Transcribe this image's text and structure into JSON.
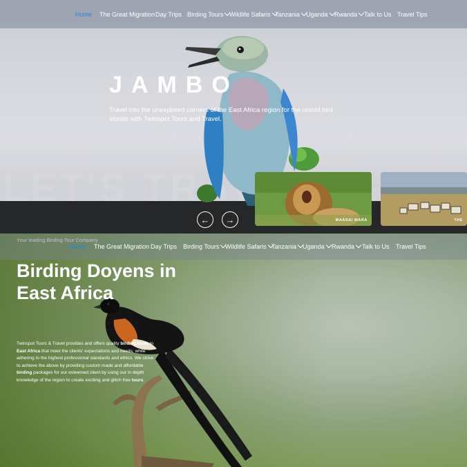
{
  "nav_top": [
    {
      "label": "Home",
      "active": true
    },
    {
      "label": "The Great Migration"
    },
    {
      "label": "Day Trips"
    },
    {
      "label": "Birding Tours",
      "caret": true
    },
    {
      "label": "Wildlife Safaris",
      "caret": true
    },
    {
      "label": "Tanzania",
      "caret": true
    },
    {
      "label": "Uganda",
      "caret": true
    },
    {
      "label": "Rwanda",
      "caret": true
    },
    {
      "label": "Talk to Us"
    },
    {
      "label": "Travel Tips"
    }
  ],
  "nav_second": [
    {
      "label": "Home",
      "active": true
    },
    {
      "label": "The Great Migration"
    },
    {
      "label": "Day Trips"
    },
    {
      "label": "Birding Tours",
      "caret": true
    },
    {
      "label": "Wildlife Safaris",
      "caret": true
    },
    {
      "label": "Tanzania",
      "caret": true
    },
    {
      "label": "Uganda",
      "caret": true
    },
    {
      "label": "Rwanda",
      "caret": true
    },
    {
      "label": "Talk to Us"
    },
    {
      "label": "Travel Tips"
    }
  ],
  "hero": {
    "title": "JAMBO",
    "subtitle": "Travel into the unexplored corners of the East Africa region for the untold bird stories with Twinspot Tours and Travel.",
    "ghost_text": "LET'S TRAVEL",
    "prev_label": "←",
    "next_label": "→"
  },
  "cards": [
    {
      "label": "MAASAI MARA"
    },
    {
      "label": "THE"
    }
  ],
  "section2": {
    "tagline": "Your leading Birding Tour Company",
    "heading": "Birding Doyens in East Africa",
    "para_parts": [
      {
        "text": "Twinspot Tours & Travel provides and offers quality ",
        "bold": false
      },
      {
        "text": "birding tours",
        "bold": true
      },
      {
        "text": " in ",
        "bold": false
      },
      {
        "text": "East Africa",
        "bold": true
      },
      {
        "text": " that meet the clients' expectations and needs, while adhering to the highest professional standards and ethics. We strive to achieve the above by providing custom made and affordable ",
        "bold": false
      },
      {
        "text": "birding",
        "bold": true
      },
      {
        "text": " packages for our esteemed client by using our in depth knowledge of the region to create exciting and glitch free ",
        "bold": false
      },
      {
        "text": "tours",
        "bold": true
      },
      {
        "text": ".",
        "bold": false
      }
    ]
  },
  "colors": {
    "accent": "#1e88e5",
    "band": "#262729"
  }
}
